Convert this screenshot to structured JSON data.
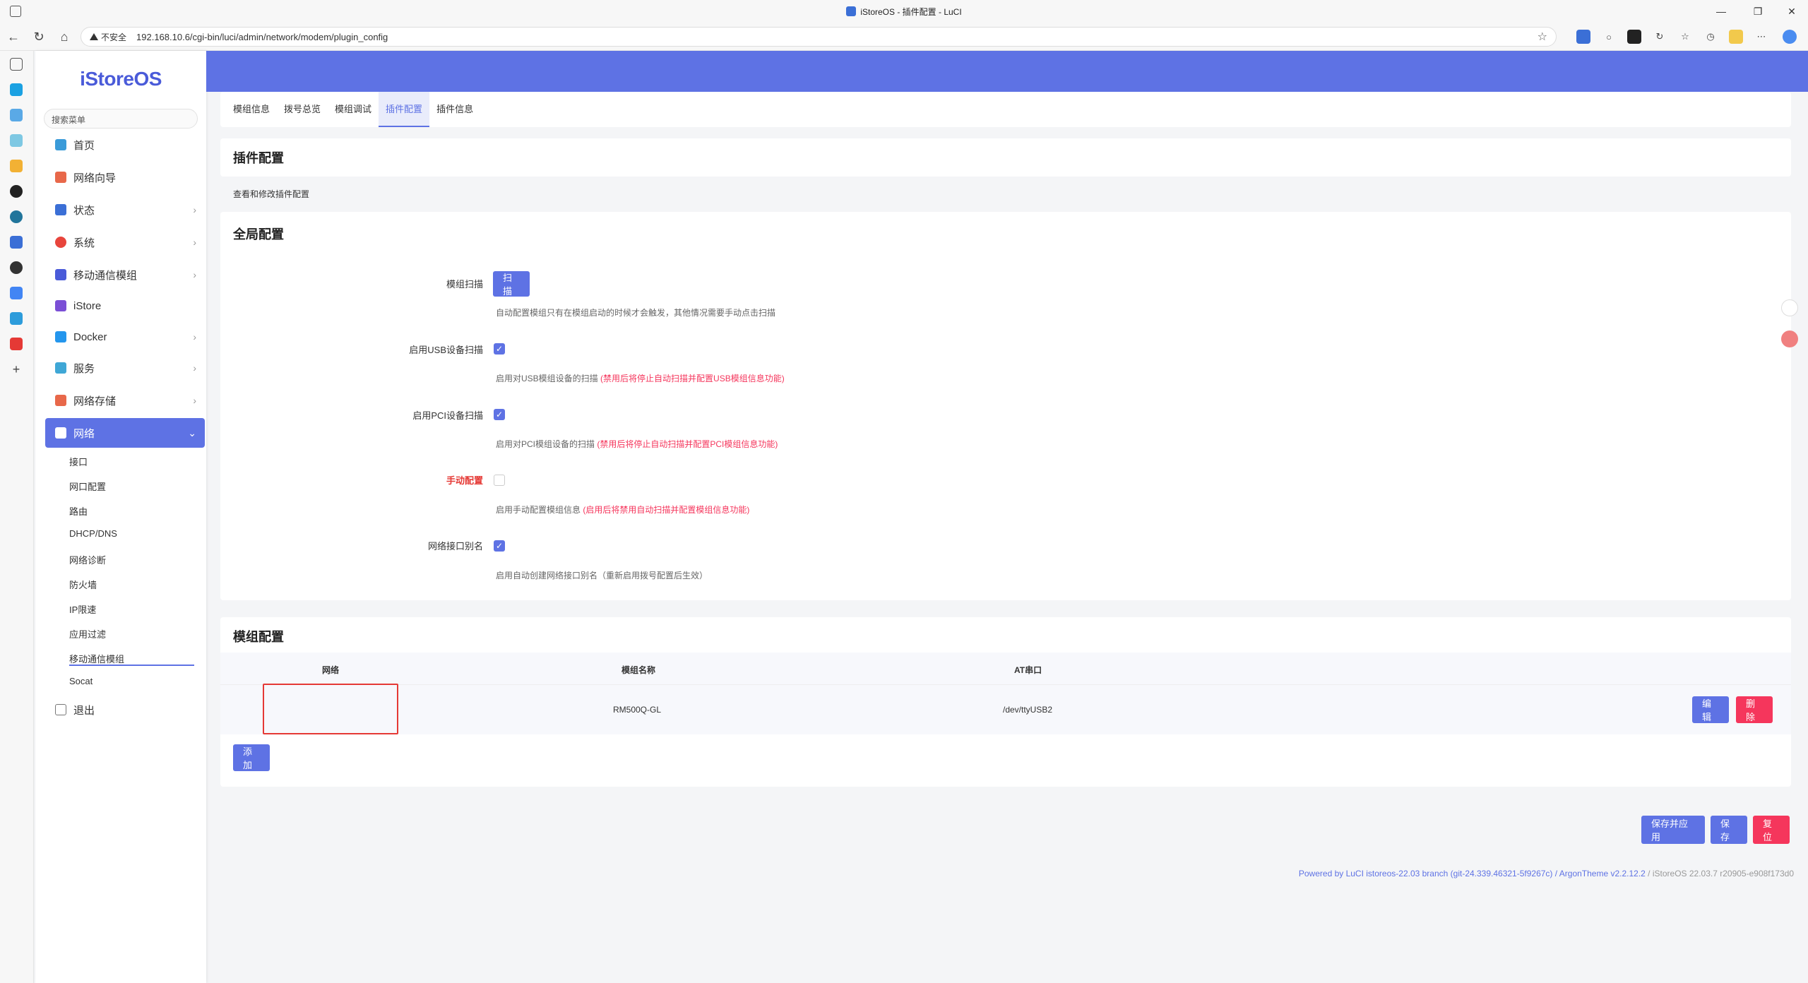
{
  "browser": {
    "window_title": "iStoreOS - 插件配置 - LuCI",
    "insecure_label": "不安全",
    "url": "192.168.10.6/cgi-bin/luci/admin/network/modem/plugin_config"
  },
  "sidebar": {
    "logo": "iStoreOS",
    "search_placeholder": "搜索菜单",
    "items": [
      {
        "label": "首页",
        "icon": "home-icon",
        "color": "#3a9bd9",
        "chevron": false
      },
      {
        "label": "网络向导",
        "icon": "wizard-icon",
        "color": "#e8684a",
        "chevron": false
      },
      {
        "label": "状态",
        "icon": "status-icon",
        "color": "#3b6fd6",
        "chevron": true
      },
      {
        "label": "系统",
        "icon": "gear-icon",
        "color": "#e8453c",
        "chevron": true
      },
      {
        "label": "移动通信模组",
        "icon": "cube-icon",
        "color": "#4a5bd9",
        "chevron": true
      },
      {
        "label": "iStore",
        "icon": "store-icon",
        "color": "#7b4fd6",
        "chevron": false
      },
      {
        "label": "Docker",
        "icon": "docker-icon",
        "color": "#2496ed",
        "chevron": true
      },
      {
        "label": "服务",
        "icon": "services-icon",
        "color": "#3fa7d6",
        "chevron": true
      },
      {
        "label": "网络存储",
        "icon": "storage-icon",
        "color": "#e8684a",
        "chevron": true
      },
      {
        "label": "网络",
        "icon": "network-icon",
        "color": "#ffffff",
        "chevron": true
      }
    ],
    "sub_items": [
      "接口",
      "网口配置",
      "路由",
      "DHCP/DNS",
      "网络诊断",
      "防火墙",
      "IP限速",
      "应用过滤",
      "移动通信模组",
      "Socat"
    ],
    "logout": "退出"
  },
  "tabs": [
    "模组信息",
    "拨号总览",
    "模组调试",
    "插件配置",
    "插件信息"
  ],
  "page": {
    "title": "插件配置",
    "description": "查看和修改插件配置"
  },
  "global": {
    "title": "全局配置",
    "scan_label": "模组扫描",
    "scan_button": "扫描",
    "scan_help": "自动配置模组只有在模组启动的时候才会触发，其他情况需要手动点击扫描",
    "usb_label": "启用USB设备扫描",
    "usb_checked": true,
    "usb_help": "启用对USB模组设备的扫描",
    "usb_warn": "(禁用后将停止自动扫描并配置USB模组信息功能)",
    "pci_label": "启用PCI设备扫描",
    "pci_checked": true,
    "pci_help": "启用对PCI模组设备的扫描",
    "pci_warn": "(禁用后将停止自动扫描并配置PCI模组信息功能)",
    "manual_label": "手动配置",
    "manual_checked": false,
    "manual_help": "启用手动配置模组信息",
    "manual_warn": "(启用后将禁用自动扫描并配置模组信息功能)",
    "alias_label": "网络接口别名",
    "alias_checked": true,
    "alias_help": "启用自动创建网络接口别名（重新启用拨号配置后生效）"
  },
  "modules": {
    "title": "模组配置",
    "columns": [
      "网络",
      "模组名称",
      "AT串口"
    ],
    "rows": [
      {
        "network": "",
        "name": "RM500Q-GL",
        "at_port": "/dev/ttyUSB2",
        "edit": "编辑",
        "delete": "删除"
      }
    ],
    "add_button": "添加"
  },
  "actions": {
    "save_apply": "保存并应用",
    "save": "保存",
    "reset": "复位"
  },
  "footer": {
    "text": "Powered by LuCI istoreos-22.03 branch (git-24.339.46321-5f9267c) / ArgonTheme v2.2.12.2",
    "version": " / iStoreOS 22.03.7 r20905-e908f173d0"
  },
  "colors": {
    "accent": "#5e72e4",
    "danger": "#f5365c"
  }
}
